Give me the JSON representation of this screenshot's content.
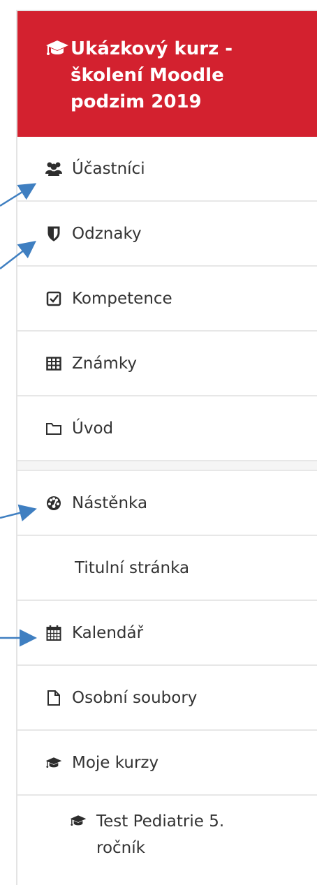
{
  "header": {
    "icon": "graduation-cap-icon",
    "title": "Ukázkový kurz - školení Moodle podzim 2019",
    "background_color": "#d3212f",
    "text_color": "#ffffff"
  },
  "course_nav": [
    {
      "label": "Účastníci",
      "icon": "users-icon"
    },
    {
      "label": "Odznaky",
      "icon": "shield-icon"
    },
    {
      "label": "Kompetence",
      "icon": "checkbox-icon"
    },
    {
      "label": "Známky",
      "icon": "table-icon"
    },
    {
      "label": "Úvod",
      "icon": "folder-icon"
    }
  ],
  "site_nav": [
    {
      "label": "Nástěnka",
      "icon": "dashboard-icon"
    },
    {
      "label": "Titulní stránka",
      "icon": ""
    },
    {
      "label": "Kalendář",
      "icon": "calendar-icon"
    },
    {
      "label": "Osobní soubory",
      "icon": "file-icon"
    },
    {
      "label": "Moje kurzy",
      "icon": "graduation-cap-icon"
    },
    {
      "label": "Test Pediatrie 5. ročník",
      "icon": "graduation-cap-icon"
    }
  ],
  "annotation_arrow_color": "#3f7fc1"
}
